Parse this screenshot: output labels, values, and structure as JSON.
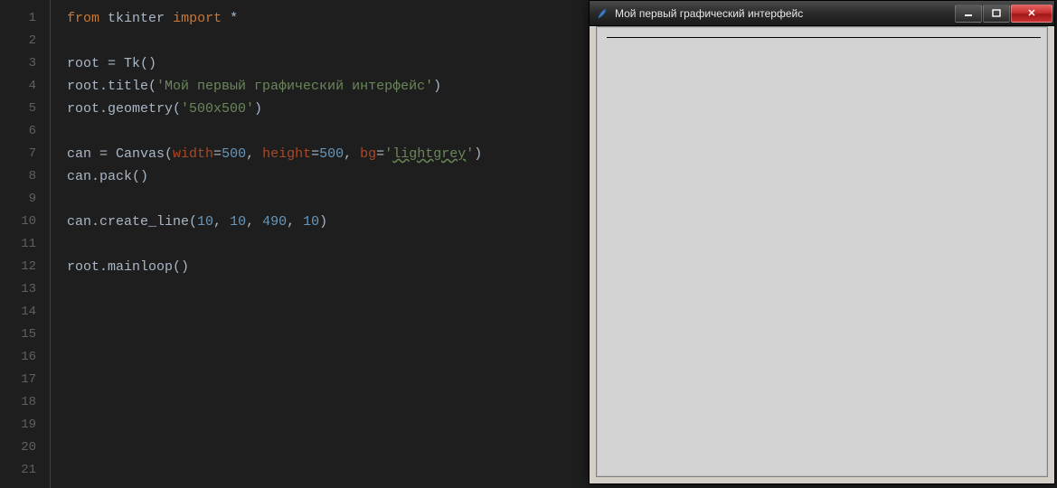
{
  "editor": {
    "lines": [
      "1",
      "2",
      "3",
      "4",
      "5",
      "6",
      "7",
      "8",
      "9",
      "10",
      "11",
      "12",
      "13",
      "14",
      "15",
      "16",
      "17",
      "18",
      "19",
      "20",
      "21"
    ],
    "code": {
      "l1": {
        "from": "from",
        "mod": "tkinter",
        "imp": "import",
        "star": "*"
      },
      "l3": {
        "a": "root = Tk()"
      },
      "l4": {
        "a": "root.title(",
        "s": "'Мой первый графический интерфейс'",
        "b": ")"
      },
      "l5": {
        "a": "root.geometry(",
        "s": "'500x500'",
        "b": ")"
      },
      "l7": {
        "a": "can = Canvas(",
        "p1": "width",
        "eq1": "=",
        "n1": "500",
        "c1": ", ",
        "p2": "height",
        "eq2": "=",
        "n2": "500",
        "c2": ", ",
        "p3": "bg",
        "eq3": "=",
        "s1a": "'",
        "s1b": "lightgrey",
        "s1c": "'",
        "b": ")"
      },
      "l8": {
        "a": "can.pack()"
      },
      "l10": {
        "a": "can.create_line(",
        "n1": "10",
        "c1": ", ",
        "n2": "10",
        "c2": ", ",
        "n3": "490",
        "c3": ", ",
        "n4": "10",
        "b": ")"
      },
      "l12": {
        "a": "root.mainloop()"
      }
    }
  },
  "tkwindow": {
    "title": "Мой первый графический интерфейс",
    "close_glyph": "✕"
  }
}
